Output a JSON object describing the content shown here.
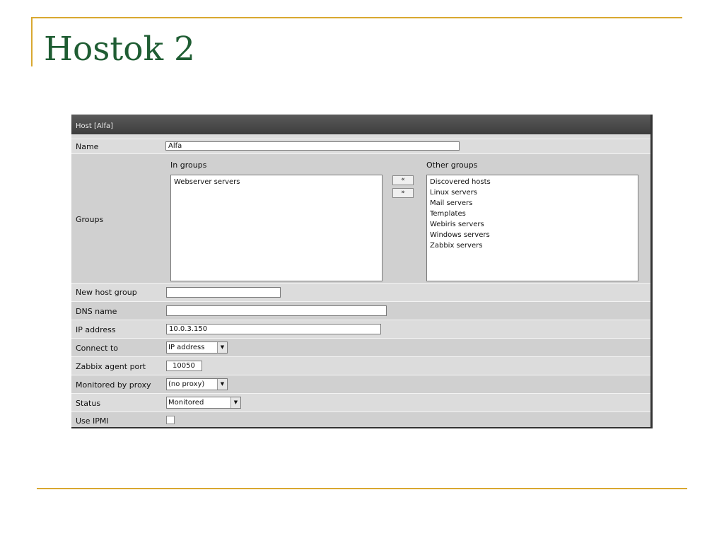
{
  "slide": {
    "title": "Hostok 2"
  },
  "form": {
    "header": "Host  [Alfa]",
    "name_label": "Name",
    "name_value": "Alfa",
    "groups_label": "Groups",
    "in_groups_label": "In groups",
    "in_groups": [
      "Webserver servers"
    ],
    "other_groups_label": "Other groups",
    "other_groups": [
      "Discovered hosts",
      "Linux servers",
      "Mail servers",
      "Templates",
      "Webiris servers",
      "Windows servers",
      "Zabbix servers"
    ],
    "move_left_label": "«",
    "move_right_label": "»",
    "new_host_group_label": "New host group",
    "new_host_group_value": "",
    "dns_name_label": "DNS name",
    "dns_name_value": "",
    "ip_address_label": "IP address",
    "ip_address_value": "10.0.3.150",
    "connect_to_label": "Connect to",
    "connect_to_value": "IP address",
    "agent_port_label": "Zabbix agent port",
    "agent_port_value": "10050",
    "proxy_label": "Monitored by proxy",
    "proxy_value": "(no proxy)",
    "status_label": "Status",
    "status_value": "Monitored",
    "ipmi_label": "Use IPMI",
    "ipmi_checked": false
  },
  "colors": {
    "title": "#1f5d33",
    "accent_rule": "#d9a830",
    "header_bg": "#4a4a4a",
    "panel_bg": "#dcdcdc"
  }
}
